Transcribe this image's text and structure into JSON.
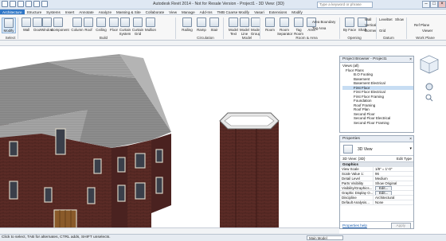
{
  "window": {
    "title": "Autodesk Revit 2014 - Not for Resale Version - Project1 - 3D View: {3D}",
    "search_placeholder": "Type a keyword or phrase"
  },
  "tabs": [
    "Architecture",
    "Structure",
    "Systems",
    "Insert",
    "Annotate",
    "Analyze",
    "Massing & Site",
    "Collaborate",
    "View",
    "Manage",
    "Add-Ins",
    "TMB Coarse Modify",
    "Vasari",
    "Extensions",
    "Modify"
  ],
  "active_tab": "Architecture",
  "ribbon": {
    "tools": [
      "Modify",
      "Wall",
      "Door",
      "Window",
      "Component",
      "Column",
      "Roof",
      "Ceiling",
      "Floor",
      "Curtain System",
      "Curtain Grid",
      "Mullion",
      "Railing",
      "Ramp",
      "Stair",
      "Model Text",
      "Model Line",
      "Model Group",
      "Room",
      "Room Separator",
      "Tag Room",
      "Area",
      "Area Boundary",
      "Tag Area",
      "By Face",
      "Shaft",
      "Wall",
      "Vertical",
      "Dormer",
      "Level",
      "Grid",
      "Set",
      "Show",
      "Ref Plane",
      "Viewer"
    ],
    "panels": [
      "Select",
      "Build",
      "Circulation",
      "Model",
      "Room & Area",
      "Opening",
      "Datum",
      "Work Plane"
    ]
  },
  "project_browser": {
    "title": "Project Browser - Project1",
    "items": [
      "Views (all)",
      "Floor Plans",
      "B.O Footing",
      "Basement",
      "Basement Electrical",
      "First Floor",
      "First Floor Electrical",
      "First Floor Framing",
      "Foundation",
      "Roof Framing",
      "Roof Plan",
      "Second Floor",
      "Second Floor Electrical",
      "Second Floor Framing"
    ],
    "selected": "First Floor"
  },
  "properties": {
    "title": "Properties",
    "type_name": "3D View",
    "instance": "3D View: {3D}",
    "edit_type": "Edit Type",
    "group": "Graphics",
    "rows": [
      {
        "key": "View Scale",
        "value": "1/8\" = 1'-0\""
      },
      {
        "key": "Scale Value 1:",
        "value": "96"
      },
      {
        "key": "Detail Level",
        "value": "Medium"
      },
      {
        "key": "Parts Visibility",
        "value": "Show Original"
      },
      {
        "key": "Visibility/Graphics...",
        "value": "Edit..."
      },
      {
        "key": "Graphic Display O...",
        "value": "Edit..."
      },
      {
        "key": "Discipline",
        "value": "Architectural"
      },
      {
        "key": "Default Analysis...",
        "value": "None"
      }
    ],
    "help": "Properties help",
    "apply": "Apply"
  },
  "status": {
    "text": "Click to select, TAB for alternates, CTRL adds, SHIFT unselects.",
    "model": "Main Model"
  },
  "colors": {
    "accent": "#2f76c6",
    "brick": "#5a2a25",
    "roof": "#8d8d8d"
  }
}
